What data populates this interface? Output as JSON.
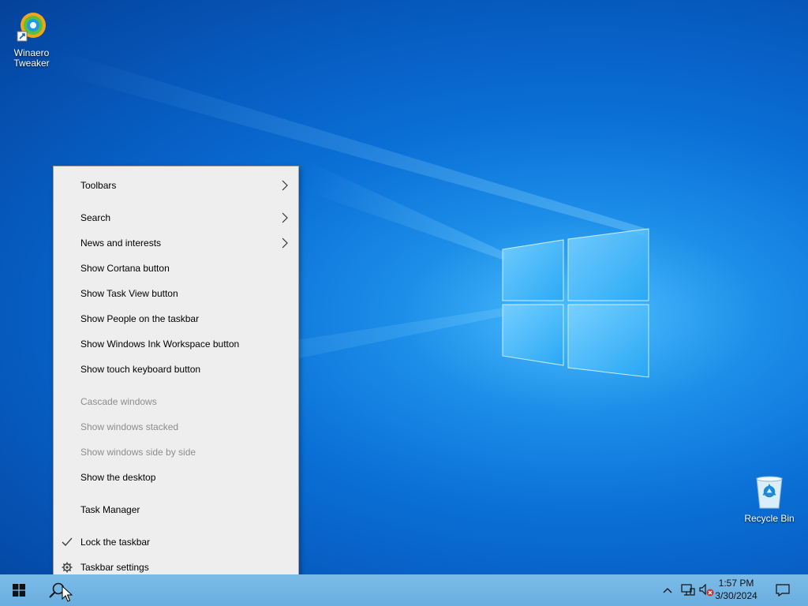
{
  "desktop": {
    "icons": [
      {
        "label_line1": "Winaero",
        "label_line2": "Tweaker"
      },
      {
        "label": "Recycle Bin"
      }
    ]
  },
  "context_menu": {
    "items": [
      {
        "label": "Toolbars",
        "submenu": true
      },
      {
        "label": "Search",
        "submenu": true
      },
      {
        "label": "News and interests",
        "submenu": true
      },
      {
        "label": "Show Cortana button"
      },
      {
        "label": "Show Task View button"
      },
      {
        "label": "Show People on the taskbar"
      },
      {
        "label": "Show Windows Ink Workspace button"
      },
      {
        "label": "Show touch keyboard button"
      },
      {
        "label": "Cascade windows",
        "disabled": true
      },
      {
        "label": "Show windows stacked",
        "disabled": true
      },
      {
        "label": "Show windows side by side",
        "disabled": true
      },
      {
        "label": "Show the desktop"
      },
      {
        "label": "Task Manager"
      },
      {
        "label": "Lock the taskbar",
        "checked": true
      },
      {
        "label": "Taskbar settings",
        "icon": "gear-icon"
      }
    ]
  },
  "taskbar": {
    "clock_time": "1:57 PM",
    "clock_date": "3/30/2024",
    "icons": [
      "windows-start-icon",
      "search-icon",
      "chevron-up-icon",
      "network-icon",
      "volume-muted-icon",
      "notifications-icon"
    ]
  },
  "colors": {
    "desktop_blue": "#0a6fd6",
    "taskbar": "#6db2e3",
    "menu_bg": "#eeeeee"
  }
}
